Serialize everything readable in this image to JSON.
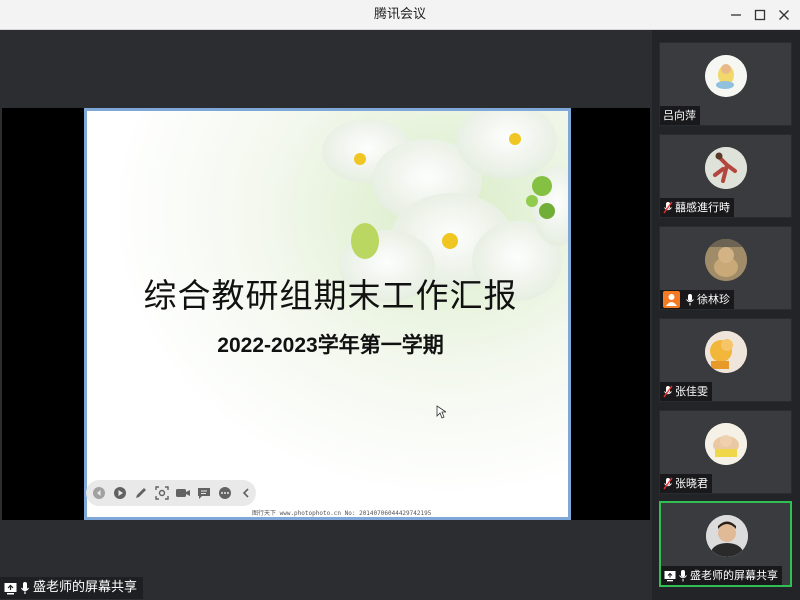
{
  "window": {
    "title": "腾讯会议"
  },
  "slide": {
    "title": "综合教研组期末工作汇报",
    "subtitle": "2022-2023学年第一学期",
    "watermark": "图行天下 www.photophoto.cn  No: 20140706044429742195"
  },
  "share_label": "盛老师的屏幕共享",
  "participants": [
    {
      "name": "吕向萍",
      "mic_muted": false
    },
    {
      "name": "囍感進行時",
      "mic_muted": true
    },
    {
      "name": "徐林珍",
      "mic_muted": false,
      "host": true
    },
    {
      "name": "张佳雯",
      "mic_muted": true
    },
    {
      "name": "张晓君",
      "mic_muted": true
    },
    {
      "name": "盛老师的屏幕共享",
      "mic_muted": false,
      "active": true
    }
  ],
  "colors": {
    "active_border": "#2fbf55",
    "host_badge": "#f57a22",
    "slide_border": "#7fa7d8"
  }
}
